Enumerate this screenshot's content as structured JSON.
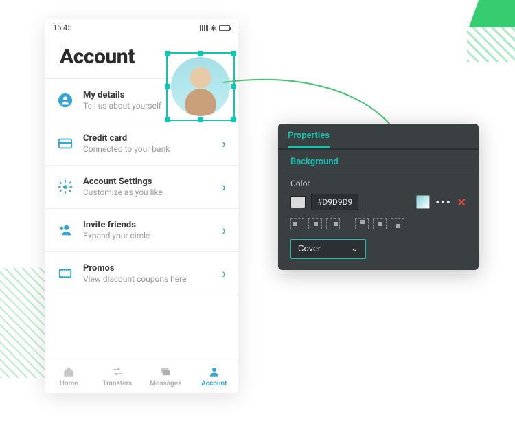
{
  "phone": {
    "time": "15:45",
    "title": "Account",
    "rows": [
      {
        "title": "My details",
        "subtitle": "Tell us about yourself"
      },
      {
        "title": "Credit card",
        "subtitle": "Connected to your bank"
      },
      {
        "title": "Account Settings",
        "subtitle": "Customize as you like"
      },
      {
        "title": "Invite friends",
        "subtitle": "Expand your circle"
      },
      {
        "title": "Promos",
        "subtitle": "View discount coupons here"
      }
    ],
    "tabs": [
      {
        "label": "Home"
      },
      {
        "label": "Transfers"
      },
      {
        "label": "Messages"
      },
      {
        "label": "Account"
      }
    ],
    "activeTab": 3
  },
  "panel": {
    "tab": "Properties",
    "section": "Background",
    "colorLabel": "Color",
    "colorHex": "#D9D9D9",
    "more": "•••",
    "remove": "✕",
    "fitMode": "Cover"
  }
}
